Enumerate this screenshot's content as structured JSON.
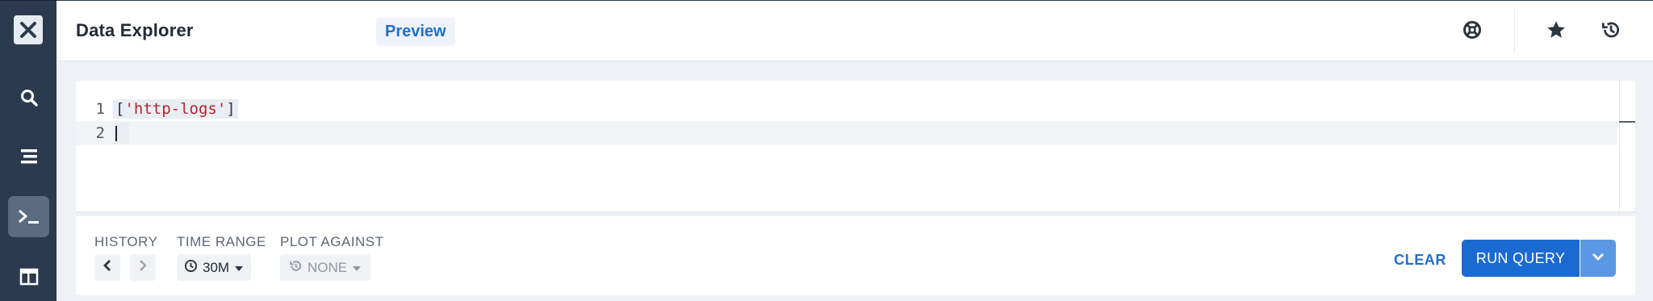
{
  "app": {
    "logo_icon": "close-x-logo-icon"
  },
  "sidebar": {
    "items": [
      {
        "name": "search",
        "icon": "search-icon"
      },
      {
        "name": "list",
        "icon": "stacked-lines-icon"
      },
      {
        "name": "terminal",
        "icon": "terminal-prompt-icon",
        "active": true
      },
      {
        "name": "dashboard",
        "icon": "layout-panel-icon"
      }
    ]
  },
  "header": {
    "title": "Data Explorer",
    "badge": "Preview",
    "icons": [
      "lifebuoy-icon",
      "star-icon",
      "history-icon"
    ]
  },
  "editor": {
    "lines": [
      {
        "number": "1",
        "open": "[",
        "string": "'http-logs'",
        "close": "]"
      },
      {
        "number": "2",
        "text": ""
      }
    ]
  },
  "controls": {
    "history_label": "HISTORY",
    "time_range_label": "TIME RANGE",
    "time_range_value": "30M",
    "plot_against_label": "PLOT AGAINST",
    "plot_against_value": "NONE",
    "clear_label": "CLEAR",
    "run_label": "RUN QUERY"
  },
  "colors": {
    "sidebar_bg": "#2b3a4e",
    "accent": "#1b6ad2",
    "string": "#b3262d"
  }
}
